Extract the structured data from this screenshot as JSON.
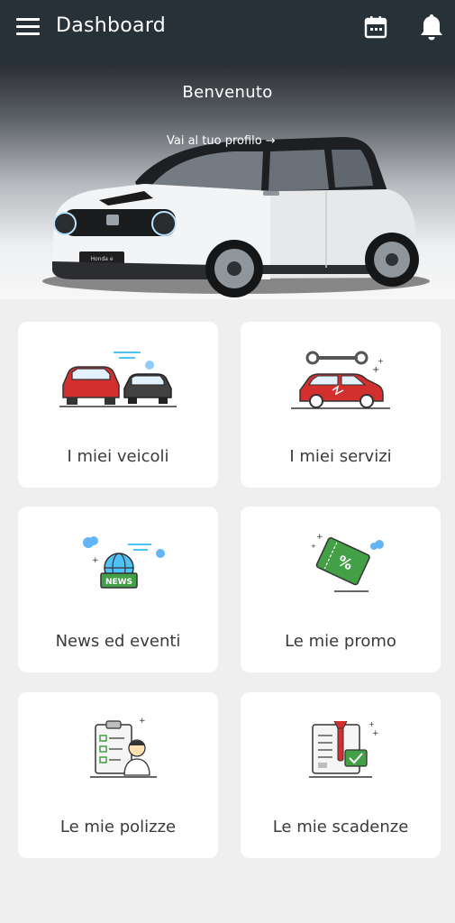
{
  "app_bar": {
    "title": "Dashboard",
    "menu_icon": "hamburger-menu-icon",
    "calendar_icon": "calendar-icon",
    "notification_icon": "bell-icon",
    "background": "#263238"
  },
  "hero": {
    "greeting": "Benvenuto",
    "profile_link": "Vai al tuo profilo",
    "link_icon": "arrow-right-icon",
    "image": "white-compact-car"
  },
  "tiles": [
    {
      "label": "I miei veicoli",
      "icon": "vehicles-icon"
    },
    {
      "label": "I miei servizi",
      "icon": "car-service-icon"
    },
    {
      "label": "News ed eventi",
      "icon": "news-globe-icon"
    },
    {
      "label": "Le mie promo",
      "icon": "promo-coupon-icon"
    },
    {
      "label": "Le mie polizze",
      "icon": "insurance-policy-icon"
    },
    {
      "label": "Le mie scadenze",
      "icon": "deadlines-checklist-icon"
    }
  ],
  "colors": {
    "accent_red": "#d32f2f",
    "accent_green": "#43a047",
    "accent_blue": "#4fc3f7",
    "page_background": "#efefef"
  }
}
